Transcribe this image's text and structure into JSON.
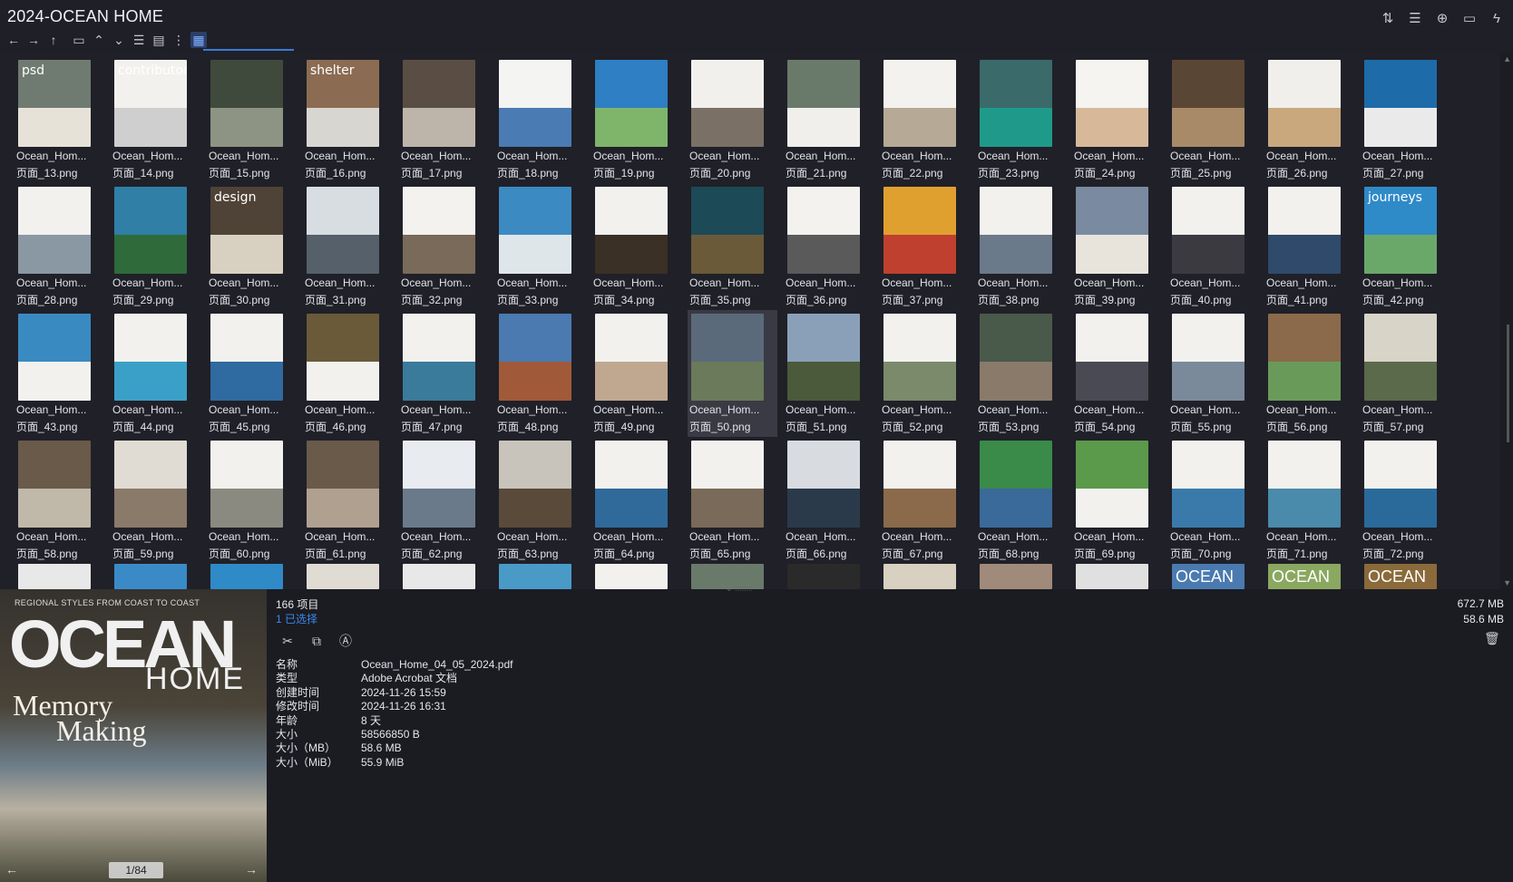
{
  "window": {
    "title": "2024-OCEAN HOME"
  },
  "toolbar_left": [
    {
      "name": "back-arrow-icon",
      "glyph": "←"
    },
    {
      "name": "forward-arrow-icon",
      "glyph": "→"
    },
    {
      "name": "up-arrow-icon",
      "glyph": "↑"
    },
    {
      "name": "chevron-up-icon",
      "glyph": "⌃"
    },
    {
      "name": "chevron-down-icon",
      "glyph": "⌄"
    }
  ],
  "toolbar_right": [
    {
      "name": "sort-icon",
      "glyph": "⇅"
    },
    {
      "name": "list-view-icon",
      "glyph": "☰"
    },
    {
      "name": "add-circle-icon",
      "glyph": "⊕"
    },
    {
      "name": "clipboard-icon",
      "glyph": "▭"
    },
    {
      "name": "lightning-icon",
      "glyph": "ϟ"
    }
  ],
  "files": [
    {
      "name": "Ocean_Hom...",
      "page": "页面_13.png",
      "c1": "#6f7b70",
      "c2": "#e7e2d8",
      "txt": "psd"
    },
    {
      "name": "Ocean_Hom...",
      "page": "页面_14.png",
      "c1": "#f2f1ee",
      "c2": "#cfcfcf",
      "txt": "contributors"
    },
    {
      "name": "Ocean_Hom...",
      "page": "页面_15.png",
      "c1": "#3f4a3c",
      "c2": "#8e9484",
      "txt": ""
    },
    {
      "name": "Ocean_Hom...",
      "page": "页面_16.png",
      "c1": "#8b6c52",
      "c2": "#d8d6d0",
      "txt": "shelter"
    },
    {
      "name": "Ocean_Hom...",
      "page": "页面_17.png",
      "c1": "#5a4e44",
      "c2": "#bdb5aa",
      "txt": ""
    },
    {
      "name": "Ocean_Hom...",
      "page": "页面_18.png",
      "c1": "#f4f4f2",
      "c2": "#4a7bb3",
      "txt": ""
    },
    {
      "name": "Ocean_Hom...",
      "page": "页面_19.png",
      "c1": "#2e7fc4",
      "c2": "#7fb56a",
      "txt": ""
    },
    {
      "name": "Ocean_Hom...",
      "page": "页面_20.png",
      "c1": "#f2f0ec",
      "c2": "#7a7066",
      "txt": ""
    },
    {
      "name": "Ocean_Hom...",
      "page": "页面_21.png",
      "c1": "#6a7a6a",
      "c2": "#f0efec",
      "txt": ""
    },
    {
      "name": "Ocean_Hom...",
      "page": "页面_22.png",
      "c1": "#f3f2ef",
      "c2": "#b6a996",
      "txt": ""
    },
    {
      "name": "Ocean_Hom...",
      "page": "页面_23.png",
      "c1": "#3a6a6a",
      "c2": "#1f9a8a",
      "txt": ""
    },
    {
      "name": "Ocean_Hom...",
      "page": "页面_24.png",
      "c1": "#f6f4f0",
      "c2": "#d7b99a",
      "txt": ""
    },
    {
      "name": "Ocean_Hom...",
      "page": "页面_25.png",
      "c1": "#5a4634",
      "c2": "#a88a68",
      "txt": ""
    },
    {
      "name": "Ocean_Hom...",
      "page": "页面_26.png",
      "c1": "#f1efeb",
      "c2": "#c9a87e",
      "txt": ""
    },
    {
      "name": "Ocean_Hom...",
      "page": "页面_27.png",
      "c1": "#1d6ba8",
      "c2": "#eaeaea",
      "txt": ""
    },
    {
      "name": "Ocean_Hom...",
      "page": "页面_28.png",
      "c1": "#f2f1ee",
      "c2": "#8a98a4",
      "txt": ""
    },
    {
      "name": "Ocean_Hom...",
      "page": "页面_29.png",
      "c1": "#2f7fa6",
      "c2": "#2f6a3a",
      "txt": ""
    },
    {
      "name": "Ocean_Hom...",
      "page": "页面_30.png",
      "c1": "#4f4236",
      "c2": "#d8d0c0",
      "txt": "design"
    },
    {
      "name": "Ocean_Hom...",
      "page": "页面_31.png",
      "c1": "#d8dde2",
      "c2": "#55606a",
      "txt": ""
    },
    {
      "name": "Ocean_Hom...",
      "page": "页面_32.png",
      "c1": "#f3f2ef",
      "c2": "#7a6a5a",
      "txt": ""
    },
    {
      "name": "Ocean_Hom...",
      "page": "页面_33.png",
      "c1": "#3b8ac2",
      "c2": "#dfe6ea",
      "txt": ""
    },
    {
      "name": "Ocean_Hom...",
      "page": "页面_34.png",
      "c1": "#f2f1ee",
      "c2": "#3a3026",
      "txt": ""
    },
    {
      "name": "Ocean_Hom...",
      "page": "页面_35.png",
      "c1": "#1c4a56",
      "c2": "#6a5a3a",
      "txt": ""
    },
    {
      "name": "Ocean_Hom...",
      "page": "页面_36.png",
      "c1": "#f3f2ef",
      "c2": "#5a5a5a",
      "txt": ""
    },
    {
      "name": "Ocean_Hom...",
      "page": "页面_37.png",
      "c1": "#e0a030",
      "c2": "#c04030",
      "txt": ""
    },
    {
      "name": "Ocean_Hom...",
      "page": "页面_38.png",
      "c1": "#f2f1ee",
      "c2": "#6a7a8a",
      "txt": ""
    },
    {
      "name": "Ocean_Hom...",
      "page": "页面_39.png",
      "c1": "#7a8aa0",
      "c2": "#e8e4dc",
      "txt": ""
    },
    {
      "name": "Ocean_Hom...",
      "page": "页面_40.png",
      "c1": "#f2f1ee",
      "c2": "#3a3a40",
      "txt": ""
    },
    {
      "name": "Ocean_Hom...",
      "page": "页面_41.png",
      "c1": "#f2f1ee",
      "c2": "#2f4a6a",
      "txt": ""
    },
    {
      "name": "Ocean_Hom...",
      "page": "页面_42.png",
      "c1": "#2f8ac8",
      "c2": "#6aa86a",
      "txt": "journeys"
    },
    {
      "name": "Ocean_Hom...",
      "page": "页面_43.png",
      "c1": "#3a8ac2",
      "c2": "#f2f1ee",
      "txt": ""
    },
    {
      "name": "Ocean_Hom...",
      "page": "页面_44.png",
      "c1": "#f2f1ee",
      "c2": "#3aa0c8",
      "txt": ""
    },
    {
      "name": "Ocean_Hom...",
      "page": "页面_45.png",
      "c1": "#f2f1ee",
      "c2": "#2f6aa0",
      "txt": ""
    },
    {
      "name": "Ocean_Hom...",
      "page": "页面_46.png",
      "c1": "#6a5a3a",
      "c2": "#f2f1ee",
      "txt": ""
    },
    {
      "name": "Ocean_Hom...",
      "page": "页面_47.png",
      "c1": "#f2f1ee",
      "c2": "#3a7a9a",
      "txt": ""
    },
    {
      "name": "Ocean_Hom...",
      "page": "页面_48.png",
      "c1": "#4a7ab0",
      "c2": "#a05a3a",
      "txt": ""
    },
    {
      "name": "Ocean_Hom...",
      "page": "页面_49.png",
      "c1": "#f2f1ee",
      "c2": "#c0a890",
      "txt": ""
    },
    {
      "name": "Ocean_Hom...",
      "page": "页面_50.png",
      "c1": "#5a6a7a",
      "c2": "#6a7a5a",
      "txt": ""
    },
    {
      "name": "Ocean_Hom...",
      "page": "页面_51.png",
      "c1": "#8aa0b8",
      "c2": "#4a5a3a",
      "txt": ""
    },
    {
      "name": "Ocean_Hom...",
      "page": "页面_52.png",
      "c1": "#f2f1ee",
      "c2": "#7a8a6a",
      "txt": ""
    },
    {
      "name": "Ocean_Hom...",
      "page": "页面_53.png",
      "c1": "#4a5a4a",
      "c2": "#8a7a6a",
      "txt": ""
    },
    {
      "name": "Ocean_Hom...",
      "page": "页面_54.png",
      "c1": "#f2f1ee",
      "c2": "#4a4a54",
      "txt": ""
    },
    {
      "name": "Ocean_Hom...",
      "page": "页面_55.png",
      "c1": "#f2f1ee",
      "c2": "#7a8a9a",
      "txt": ""
    },
    {
      "name": "Ocean_Hom...",
      "page": "页面_56.png",
      "c1": "#8a6a4a",
      "c2": "#6a9a5a",
      "txt": ""
    },
    {
      "name": "Ocean_Hom...",
      "page": "页面_57.png",
      "c1": "#d8d4c8",
      "c2": "#5a6a4a",
      "txt": ""
    },
    {
      "name": "Ocean_Hom...",
      "page": "页面_58.png",
      "c1": "#6a5a4a",
      "c2": "#c0b8a8",
      "txt": ""
    },
    {
      "name": "Ocean_Hom...",
      "page": "页面_59.png",
      "c1": "#e0dcd4",
      "c2": "#8a7a6a",
      "txt": ""
    },
    {
      "name": "Ocean_Hom...",
      "page": "页面_60.png",
      "c1": "#f2f1ee",
      "c2": "#8a8a80",
      "txt": ""
    },
    {
      "name": "Ocean_Hom...",
      "page": "页面_61.png",
      "c1": "#6a5a4a",
      "c2": "#b0a090",
      "txt": ""
    },
    {
      "name": "Ocean_Hom...",
      "page": "页面_62.png",
      "c1": "#e8ecf0",
      "c2": "#6a7a8a",
      "txt": ""
    },
    {
      "name": "Ocean_Hom...",
      "page": "页面_63.png",
      "c1": "#c8c4bc",
      "c2": "#5a4a3a",
      "txt": ""
    },
    {
      "name": "Ocean_Hom...",
      "page": "页面_64.png",
      "c1": "#f2f1ee",
      "c2": "#2f6a9a",
      "txt": ""
    },
    {
      "name": "Ocean_Hom...",
      "page": "页面_65.png",
      "c1": "#f2f1ee",
      "c2": "#7a6a5a",
      "txt": ""
    },
    {
      "name": "Ocean_Hom...",
      "page": "页面_66.png",
      "c1": "#d8dce0",
      "c2": "#2a3a4a",
      "txt": ""
    },
    {
      "name": "Ocean_Hom...",
      "page": "页面_67.png",
      "c1": "#f2f1ee",
      "c2": "#8a6a4a",
      "txt": ""
    },
    {
      "name": "Ocean_Hom...",
      "page": "页面_68.png",
      "c1": "#3a8a4a",
      "c2": "#3a6a9a",
      "txt": ""
    },
    {
      "name": "Ocean_Hom...",
      "page": "页面_69.png",
      "c1": "#5a9a4a",
      "c2": "#f2f1ee",
      "txt": ""
    },
    {
      "name": "Ocean_Hom...",
      "page": "页面_70.png",
      "c1": "#f2f1ee",
      "c2": "#3a7aaa",
      "txt": ""
    },
    {
      "name": "Ocean_Hom...",
      "page": "页面_71.png",
      "c1": "#f2f1ee",
      "c2": "#4a8aaa",
      "txt": ""
    },
    {
      "name": "Ocean_Hom...",
      "page": "页面_72.png",
      "c1": "#f2f1ee",
      "c2": "#2a6a9a",
      "txt": ""
    }
  ],
  "partial_row": [
    {
      "c": "#e8e8e8",
      "txt": ""
    },
    {
      "c": "#3a8ac8",
      "txt": ""
    },
    {
      "c": "#2f8ac8",
      "txt": ""
    },
    {
      "c": "#e0dcd4",
      "txt": ""
    },
    {
      "c": "#e8e8e8",
      "txt": ""
    },
    {
      "c": "#4a9ac8",
      "txt": ""
    },
    {
      "c": "#f2f1ee",
      "txt": ""
    },
    {
      "c": "#6a7a6a",
      "txt": ""
    },
    {
      "c": "#2a2a2a",
      "txt": ""
    },
    {
      "c": "#d8d0c0",
      "txt": ""
    },
    {
      "c": "#a08a7a",
      "txt": ""
    },
    {
      "c": "#e0e0e0",
      "txt": ""
    },
    {
      "c": "#4a7ab0",
      "txt": "OCEAN"
    },
    {
      "c": "#8aa860",
      "txt": "OCEAN"
    },
    {
      "c": "#8a6a3a",
      "txt": "OCEAN"
    }
  ],
  "details": {
    "item_count": "166 项目",
    "selected": "1 已选择",
    "total_size": "672.7 MB",
    "selected_size": "58.6 MB",
    "properties": [
      {
        "key": "名称",
        "value": "Ocean_Home_04_05_2024.pdf"
      },
      {
        "key": "类型",
        "value": "Adobe Acrobat 文档"
      },
      {
        "key": "创建时间",
        "value": "2024-11-26  15:59"
      },
      {
        "key": "修改时间",
        "value": "2024-11-26  16:31"
      },
      {
        "key": "年龄",
        "value": "8 天"
      },
      {
        "key": "大小",
        "value": "58566850 B"
      },
      {
        "key": "大小（MB）",
        "value": "58.6 MB"
      },
      {
        "key": "大小（MiB）",
        "value": "55.9 MiB"
      }
    ],
    "actions": [
      {
        "name": "cut-icon",
        "glyph": "✂"
      },
      {
        "name": "copy-icon",
        "glyph": "⧉"
      },
      {
        "name": "rename-icon",
        "glyph": "Ⓐ"
      }
    ]
  },
  "preview": {
    "tagline": "REGIONAL STYLES FROM COAST TO COAST",
    "masthead": "OCEAN",
    "masthead_sub": "HOME",
    "headline_1": "Memory",
    "headline_2": "Making",
    "page_indicator": "1/84"
  }
}
